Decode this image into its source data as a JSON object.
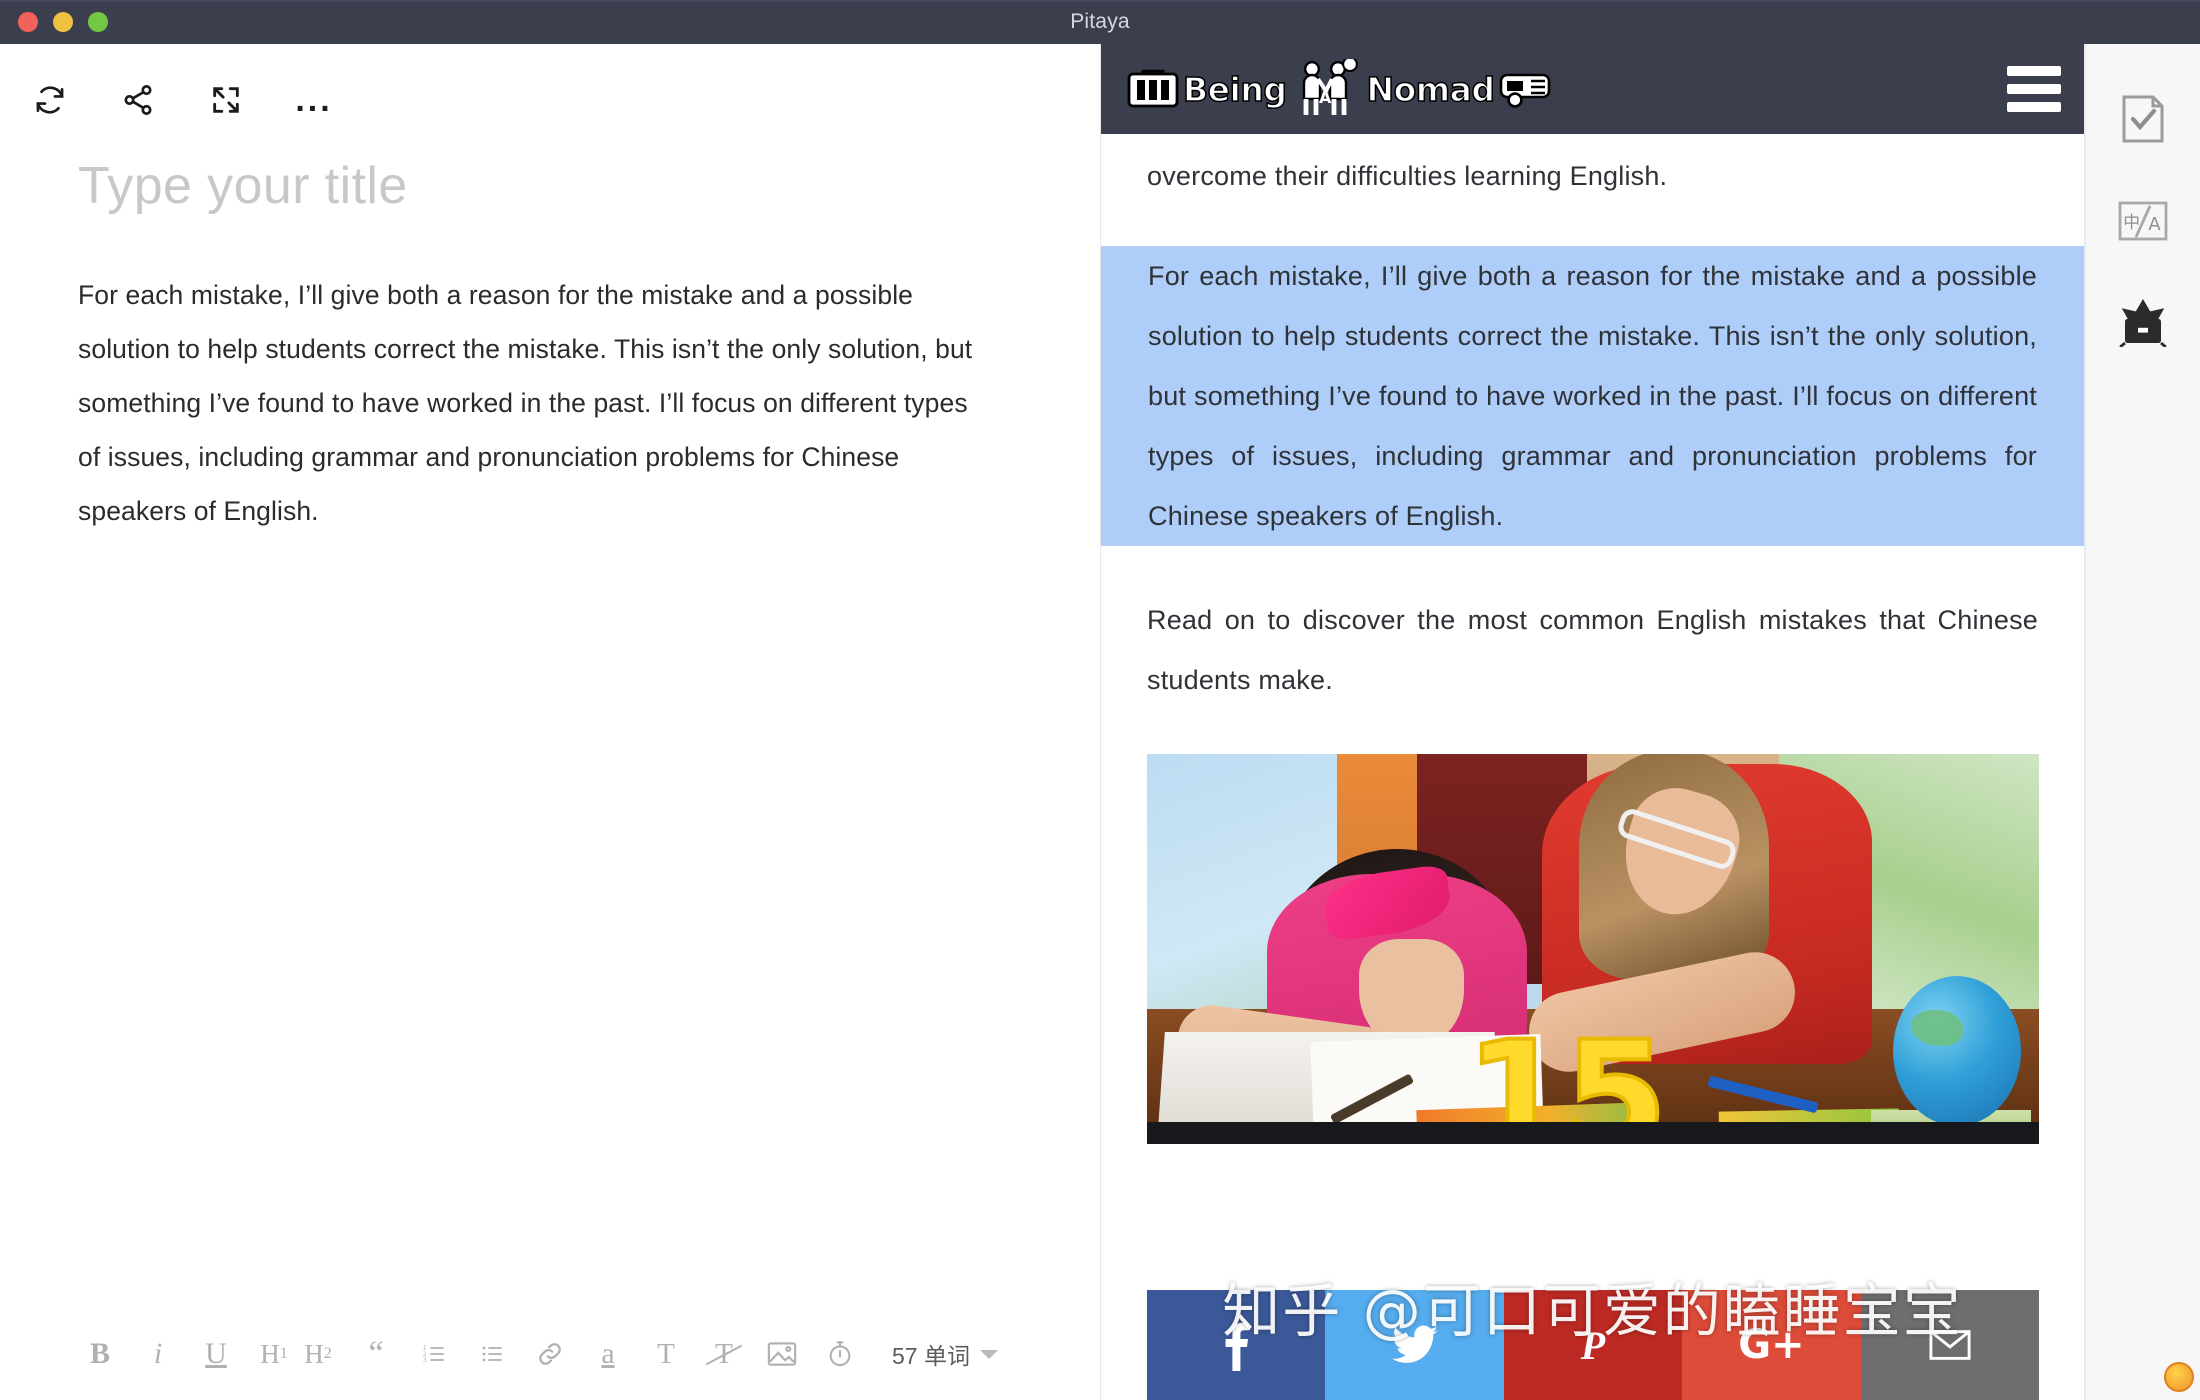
{
  "window": {
    "title": "Pitaya",
    "traffic_lights": [
      "close",
      "minimize",
      "zoom"
    ]
  },
  "editor": {
    "toolbar": [
      {
        "name": "sync-icon",
        "label": "Sync"
      },
      {
        "name": "share-icon",
        "label": "Share"
      },
      {
        "name": "fullscreen-icon",
        "label": "Fullscreen"
      },
      {
        "name": "more-icon",
        "label": "..."
      }
    ],
    "title_placeholder": "Type your title",
    "body": "For each mistake, I’ll give both a reason for the mistake and a possible solution to help students correct the mistake. This isn’t the only solution, but something I’ve found to have worked in the past. I’ll focus on different types of issues, including grammar and pronunciation problems for Chinese speakers of English.",
    "format_bar": [
      {
        "name": "bold-button",
        "glyph": "B"
      },
      {
        "name": "italic-button",
        "glyph": "i"
      },
      {
        "name": "underline-button",
        "glyph": "U"
      },
      {
        "name": "heading1-button",
        "glyph": "H1"
      },
      {
        "name": "heading2-button",
        "glyph": "H2"
      },
      {
        "name": "blockquote-button",
        "glyph": "“"
      },
      {
        "name": "ordered-list-button",
        "glyph": "ol"
      },
      {
        "name": "bullet-list-button",
        "glyph": "ul"
      },
      {
        "name": "link-button",
        "glyph": "link"
      },
      {
        "name": "highlight-button",
        "glyph": "a"
      },
      {
        "name": "text-style-button",
        "glyph": "T"
      },
      {
        "name": "clear-format-button",
        "glyph": "T✕"
      },
      {
        "name": "insert-image-button",
        "glyph": "image"
      },
      {
        "name": "timer-button",
        "glyph": "timer"
      }
    ],
    "word_count": "57 单词"
  },
  "preview": {
    "site_logo": {
      "text_left": "Being",
      "text_right": "Nomad",
      "middle_letter": "A"
    },
    "menu_label": "menu",
    "paragraph_top": "… to Chinese students. But students can use it well to help them overcome their difficulties learning English.",
    "paragraph_selected": "For each mistake, I’ll give both a reason for the mistake and a possible solution to help students correct the mistake. This isn’t the only solution, but something I’ve found to have worked in the past. I’ll focus on different types of issues, including grammar and pronunciation problems for Chinese speakers of English.",
    "paragraph_after": "Read on to discover the most common English mistakes that Chinese students make.",
    "figure_number": "15",
    "share_buttons": [
      {
        "name": "share-facebook",
        "glyph": "f",
        "color": "#3b5998"
      },
      {
        "name": "share-twitter",
        "glyph": "🐦",
        "color": "#55acee"
      },
      {
        "name": "share-pinterest",
        "glyph": "𝐏",
        "color": "#bd2a24"
      },
      {
        "name": "share-googleplus",
        "glyph": "G+",
        "color": "#dd4b39"
      },
      {
        "name": "share-email",
        "glyph": "✉",
        "color": "#6e6e6e"
      }
    ],
    "watermark": "知乎 @可口可爱的瞌睡宝宝"
  },
  "rail": {
    "items": [
      {
        "name": "proofread-icon",
        "label": "Proofread"
      },
      {
        "name": "translate-icon",
        "label": "中/A"
      },
      {
        "name": "archive-icon",
        "label": "Archive"
      }
    ]
  },
  "colors": {
    "chrome": "#3b3e4d",
    "selection": "#aecdf8",
    "rail_bg": "#f7f7f8",
    "title_placeholder": "#c8c8cc"
  }
}
